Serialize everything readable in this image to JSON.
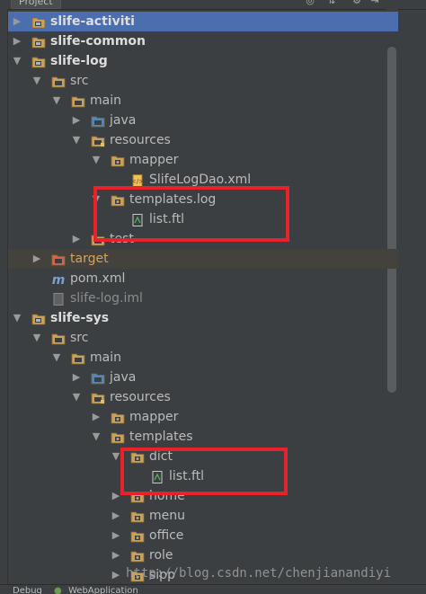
{
  "header": {
    "tab_label": "Project"
  },
  "tree": [
    {
      "label": "slife-activiti",
      "bold": true,
      "state": "collapsed",
      "icon": "module-folder-icon",
      "selected": true
    },
    {
      "label": "slife-common",
      "bold": true,
      "state": "collapsed",
      "icon": "module-folder-icon"
    },
    {
      "label": "slife-log",
      "bold": true,
      "state": "expanded",
      "icon": "module-folder-icon"
    },
    {
      "label": "src",
      "state": "expanded",
      "icon": "folder-icon"
    },
    {
      "label": "main",
      "state": "expanded",
      "icon": "folder-icon"
    },
    {
      "label": "java",
      "state": "collapsed",
      "icon": "source-folder-icon"
    },
    {
      "label": "resources",
      "state": "expanded",
      "icon": "resources-folder-icon"
    },
    {
      "label": "mapper",
      "state": "expanded",
      "icon": "package-icon"
    },
    {
      "label": "SlifeLogDao.xml",
      "state": "leaf",
      "icon": "xml-file-icon"
    },
    {
      "label": "templates.log",
      "state": "expanded",
      "icon": "package-icon"
    },
    {
      "label": "list.ftl",
      "state": "leaf",
      "icon": "ftl-file-icon"
    },
    {
      "label": "test",
      "state": "collapsed",
      "icon": "folder-icon"
    },
    {
      "label": "target",
      "state": "collapsed",
      "icon": "excluded-folder-icon",
      "excluded": true,
      "orange": true
    },
    {
      "label": "pom.xml",
      "state": "leaf",
      "icon": "maven-file-icon"
    },
    {
      "label": "slife-log.iml",
      "state": "leaf",
      "icon": "iml-file-icon",
      "muted": true
    },
    {
      "label": "slife-sys",
      "bold": true,
      "state": "expanded",
      "icon": "module-folder-icon"
    },
    {
      "label": "src",
      "state": "expanded",
      "icon": "folder-icon"
    },
    {
      "label": "main",
      "state": "expanded",
      "icon": "folder-icon"
    },
    {
      "label": "java",
      "state": "collapsed",
      "icon": "source-folder-icon"
    },
    {
      "label": "resources",
      "state": "expanded",
      "icon": "resources-folder-icon"
    },
    {
      "label": "mapper",
      "state": "collapsed",
      "icon": "package-icon"
    },
    {
      "label": "templates",
      "state": "expanded",
      "icon": "package-icon"
    },
    {
      "label": "dict",
      "state": "expanded",
      "icon": "package-icon"
    },
    {
      "label": "list.ftl",
      "state": "leaf",
      "icon": "ftl-file-icon"
    },
    {
      "label": "home",
      "state": "collapsed",
      "icon": "package-icon"
    },
    {
      "label": "menu",
      "state": "collapsed",
      "icon": "package-icon"
    },
    {
      "label": "office",
      "state": "collapsed",
      "icon": "package-icon"
    },
    {
      "label": "role",
      "state": "collapsed",
      "icon": "package-icon"
    },
    {
      "label": "sipp",
      "state": "collapsed",
      "icon": "package-icon"
    }
  ],
  "footer": {
    "debug_label": "Debug",
    "run_config_label": "WebApplication"
  },
  "watermark": "http://blog.csdn.net/chenjianandiyi",
  "colors": {
    "panel_bg": "#3c3f41",
    "selection": "#4b6eaf",
    "highlight_box": "#e8222a",
    "folder": "#c9a15a",
    "source_folder": "#4a88c7"
  }
}
